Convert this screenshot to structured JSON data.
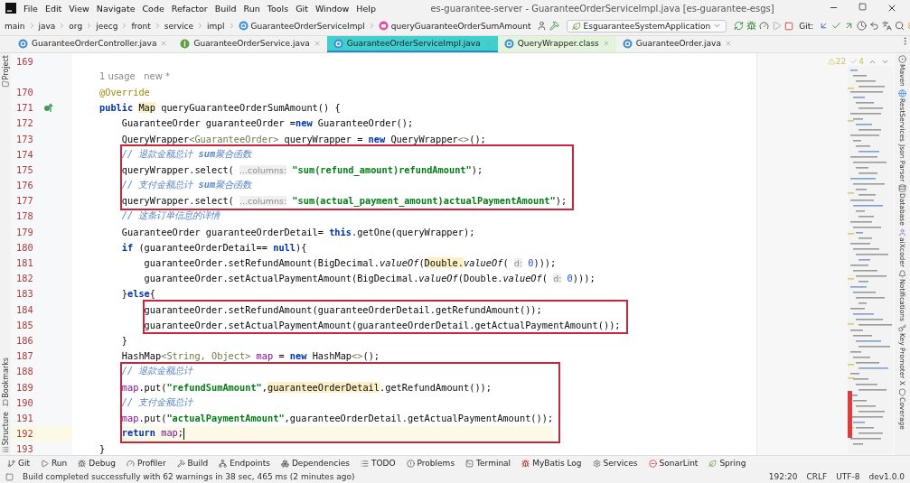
{
  "window": {
    "title": "es-guarantee-server - GuaranteeOrderServiceImpl.java [es-guarantee-esgs]"
  },
  "menu": [
    "File",
    "Edit",
    "View",
    "Navigate",
    "Code",
    "Refactor",
    "Build",
    "Run",
    "Tools",
    "Git",
    "Window",
    "Help"
  ],
  "breadcrumb": [
    {
      "label": "main",
      "kind": "folder"
    },
    {
      "label": "java",
      "kind": "folder"
    },
    {
      "label": "org",
      "kind": "folder"
    },
    {
      "label": "jeecg",
      "kind": "folder"
    },
    {
      "label": "front",
      "kind": "folder"
    },
    {
      "label": "service",
      "kind": "folder"
    },
    {
      "label": "impl",
      "kind": "folder"
    },
    {
      "label": "GuaranteeOrderServiceImpl",
      "kind": "class"
    },
    {
      "label": "queryGuaranteeOrderSumAmount",
      "kind": "method"
    }
  ],
  "run_config": "EsguaranteeSystemApplication",
  "git_label": "Git:",
  "tabs": [
    {
      "label": "GuaranteeOrderController.java",
      "kind": "class",
      "selected": false
    },
    {
      "label": "GuaranteeOrderService.java",
      "kind": "interface",
      "selected": false
    },
    {
      "label": "GuaranteeOrderServiceImpl.java",
      "kind": "class",
      "selected": true
    },
    {
      "label": "QueryWrapper.class",
      "kind": "library",
      "selected": false
    },
    {
      "label": "GuaranteeOrder.java",
      "kind": "class",
      "selected": false
    }
  ],
  "left_tool_windows": [
    {
      "label": "Project",
      "kind": "top"
    },
    {
      "label": "Bookmarks",
      "kind": "bottom"
    },
    {
      "label": "Structure",
      "kind": "bottom"
    }
  ],
  "inspections": {
    "warnings": "22",
    "weak_warnings": "4"
  },
  "editor": {
    "lines": [
      {
        "kind": "code",
        "number": "169"
      },
      {
        "kind": "inlay",
        "text": "1 usage   new *"
      },
      {
        "kind": "code",
        "number": "170",
        "tokens": [
          {
            "kind": "annotation",
            "text": "@Override"
          }
        ]
      },
      {
        "kind": "code",
        "number": "171",
        "overrides": true,
        "tokens": [
          {
            "kind": "keyword",
            "text": "public "
          },
          {
            "kind": "marked",
            "text": "Map"
          },
          {
            "kind": "plain",
            "text": " queryGuaranteeOrderSumAmount() {"
          }
        ]
      },
      {
        "kind": "code",
        "number": "172",
        "tokens": [
          {
            "kind": "plain",
            "text": "    GuaranteeOrder guaranteeOrder ="
          },
          {
            "kind": "keyword",
            "text": "new"
          },
          {
            "kind": "plain",
            "text": " GuaranteeOrder();"
          }
        ]
      },
      {
        "kind": "code",
        "number": "173",
        "tokens": [
          {
            "kind": "plain",
            "text": "    QueryWrapper"
          },
          {
            "kind": "generic",
            "text": "<GuaranteeOrder>"
          },
          {
            "kind": "plain",
            "text": " queryWrapper = "
          },
          {
            "kind": "keyword",
            "text": "new"
          },
          {
            "kind": "plain",
            "text": " QueryWrapper"
          },
          {
            "kind": "generic",
            "text": "<>"
          },
          {
            "kind": "plain",
            "text": "();"
          }
        ]
      },
      {
        "kind": "code",
        "number": "174",
        "boxed": true,
        "tokens": [
          {
            "kind": "comment",
            "text": "    // 退款金额总计 **sum**聚合函数"
          }
        ]
      },
      {
        "kind": "code",
        "number": "175",
        "boxed": true,
        "tokens": [
          {
            "kind": "plain",
            "text": "    queryWrapper.select( "
          },
          {
            "kind": "hint",
            "text": "...columns:"
          },
          {
            "kind": "string",
            "text": " \"sum(refund_amount)refundAmount\""
          },
          {
            "kind": "plain",
            "text": ");"
          }
        ]
      },
      {
        "kind": "code",
        "number": "176",
        "boxed": true,
        "tokens": [
          {
            "kind": "comment",
            "text": "    // 支付金额总计 **sum**聚合函数"
          }
        ]
      },
      {
        "kind": "code",
        "number": "177",
        "boxed": true,
        "tokens": [
          {
            "kind": "plain",
            "text": "    queryWrapper.select( "
          },
          {
            "kind": "hint",
            "text": "...columns:"
          },
          {
            "kind": "string",
            "text": " \"sum(actual_payment_amount)actualPaymentAmount\""
          },
          {
            "kind": "plain",
            "text": ");"
          }
        ]
      },
      {
        "kind": "code",
        "number": "178",
        "tokens": [
          {
            "kind": "comment",
            "text": "    // 这条订单信息的详情"
          }
        ]
      },
      {
        "kind": "code",
        "number": "179",
        "tokens": [
          {
            "kind": "plain",
            "text": "    GuaranteeOrder guaranteeOrderDetail= "
          },
          {
            "kind": "keyword",
            "text": "this"
          },
          {
            "kind": "plain",
            "text": ".getOne(queryWrapper);"
          }
        ]
      },
      {
        "kind": "code",
        "number": "180",
        "tokens": [
          {
            "kind": "keyword",
            "text": "    if"
          },
          {
            "kind": "plain",
            "text": " (guaranteeOrderDetail== "
          },
          {
            "kind": "keyword",
            "text": "null"
          },
          {
            "kind": "plain",
            "text": "){"
          }
        ]
      },
      {
        "kind": "code",
        "number": "181",
        "tokens": [
          {
            "kind": "plain",
            "text": "        guaranteeOrder.setRefundAmount(BigDecimal."
          },
          {
            "kind": "italic",
            "text": "valueOf"
          },
          {
            "kind": "plain",
            "text": "("
          },
          {
            "kind": "marked",
            "text": "Double."
          },
          {
            "kind": "italic",
            "text": "valueOf"
          },
          {
            "kind": "plain",
            "text": "( "
          },
          {
            "kind": "hint",
            "text": "d:"
          },
          {
            "kind": "number",
            "text": " 0"
          },
          {
            "kind": "plain",
            "text": ")));"
          }
        ]
      },
      {
        "kind": "code",
        "number": "182",
        "tokens": [
          {
            "kind": "plain",
            "text": "        guaranteeOrder.setActualPaymentAmount(BigDecimal."
          },
          {
            "kind": "italic",
            "text": "valueOf"
          },
          {
            "kind": "plain",
            "text": "(Double."
          },
          {
            "kind": "italic",
            "text": "valueOf"
          },
          {
            "kind": "plain",
            "text": "( "
          },
          {
            "kind": "hint",
            "text": "d:"
          },
          {
            "kind": "number",
            "text": " 0"
          },
          {
            "kind": "plain",
            "text": ")));"
          }
        ]
      },
      {
        "kind": "code",
        "number": "183",
        "tokens": [
          {
            "kind": "plain",
            "text": "    }"
          },
          {
            "kind": "keyword",
            "text": "else"
          },
          {
            "kind": "plain",
            "text": "{"
          }
        ]
      },
      {
        "kind": "code",
        "number": "184",
        "boxed": true,
        "tokens": [
          {
            "kind": "plain",
            "text": "        guaranteeOrder.setRefundAmount(guaranteeOrderDetail.getRefundAmount());"
          }
        ]
      },
      {
        "kind": "code",
        "number": "185",
        "boxed": true,
        "tokens": [
          {
            "kind": "plain",
            "text": "        guaranteeOrder.setActualPaymentAmount(guaranteeOrderDetail.getActualPaymentAmount());"
          }
        ]
      },
      {
        "kind": "code",
        "number": "186",
        "tokens": [
          {
            "kind": "plain",
            "text": "    }"
          }
        ]
      },
      {
        "kind": "code",
        "number": "187",
        "tokens": [
          {
            "kind": "plain",
            "text": "    HashMap"
          },
          {
            "kind": "generic",
            "text": "<String, Object>"
          },
          {
            "kind": "field",
            "text": " map"
          },
          {
            "kind": "plain",
            "text": " = "
          },
          {
            "kind": "keyword",
            "text": "new"
          },
          {
            "kind": "plain",
            "text": " HashMap"
          },
          {
            "kind": "generic",
            "text": "<>"
          },
          {
            "kind": "plain",
            "text": "();"
          }
        ]
      },
      {
        "kind": "code",
        "number": "188",
        "boxed": true,
        "tokens": [
          {
            "kind": "comment",
            "text": "    // 退款金额总计"
          }
        ]
      },
      {
        "kind": "code",
        "number": "189",
        "boxed": true,
        "tokens": [
          {
            "kind": "field",
            "text": "    map"
          },
          {
            "kind": "plain",
            "text": ".put("
          },
          {
            "kind": "string",
            "text": "\"refundSumAmount\""
          },
          {
            "kind": "plain",
            "text": ","
          },
          {
            "kind": "marked",
            "text": "guaranteeOrderDetail"
          },
          {
            "kind": "plain",
            "text": ".getRefundAmount());"
          }
        ]
      },
      {
        "kind": "code",
        "number": "190",
        "boxed": true,
        "tokens": [
          {
            "kind": "comment",
            "text": "    // 支付金额总计"
          }
        ]
      },
      {
        "kind": "code",
        "number": "191",
        "boxed": true,
        "tokens": [
          {
            "kind": "field",
            "text": "    map"
          },
          {
            "kind": "plain",
            "text": ".put("
          },
          {
            "kind": "string",
            "text": "\"actualPaymentAmount\""
          },
          {
            "kind": "plain",
            "text": ",guaranteeOrderDetail.getActualPaymentAmount());"
          }
        ]
      },
      {
        "kind": "code",
        "number": "192",
        "boxed": true,
        "caret": true,
        "tokens": [
          {
            "kind": "keyword",
            "text": "    return "
          },
          {
            "kind": "field",
            "text": "map"
          },
          {
            "kind": "plain",
            "text": ";"
          }
        ]
      },
      {
        "kind": "code",
        "number": "193",
        "tokens": [
          {
            "kind": "plain",
            "text": "}"
          }
        ]
      }
    ]
  },
  "right_tool_windows": [
    {
      "label": "Maven",
      "kind": "maven"
    },
    {
      "label": "RestServices",
      "kind": "rest"
    },
    {
      "label": "Json Parser",
      "kind": "none"
    },
    {
      "label": "Database",
      "kind": "database"
    },
    {
      "label": "aiXcoder",
      "kind": "ai"
    },
    {
      "label": "Notifications",
      "kind": "bell"
    },
    {
      "label": "Key Promoter X",
      "kind": "key"
    },
    {
      "label": "Coverage",
      "kind": "shield"
    }
  ],
  "bottom_tool_windows": [
    {
      "label": "Git",
      "kind": "git"
    },
    {
      "label": "Run",
      "kind": "run"
    },
    {
      "label": "Debug",
      "kind": "debug"
    },
    {
      "label": "Profiler",
      "kind": "profiler"
    },
    {
      "label": "Build",
      "kind": "build"
    },
    {
      "label": "Endpoints",
      "kind": "endpoints"
    },
    {
      "label": "Dependencies",
      "kind": "dependencies"
    },
    {
      "label": "TODO",
      "kind": "todo"
    },
    {
      "label": "Problems",
      "kind": "problems"
    },
    {
      "label": "Terminal",
      "kind": "terminal"
    },
    {
      "label": "MyBatis Log",
      "kind": "mybatis"
    },
    {
      "label": "Services",
      "kind": "services"
    },
    {
      "label": "SonarLint",
      "kind": "sonar"
    },
    {
      "label": "Spring",
      "kind": "spring"
    }
  ],
  "status_bar": {
    "message": "Build completed successfully with 62 warnings in 38 sec, 465 ms (2 minutes ago)",
    "position": "192:20",
    "line_separator": "CRLF",
    "encoding": "UTF-8",
    "branch": "dev1.0.0"
  }
}
